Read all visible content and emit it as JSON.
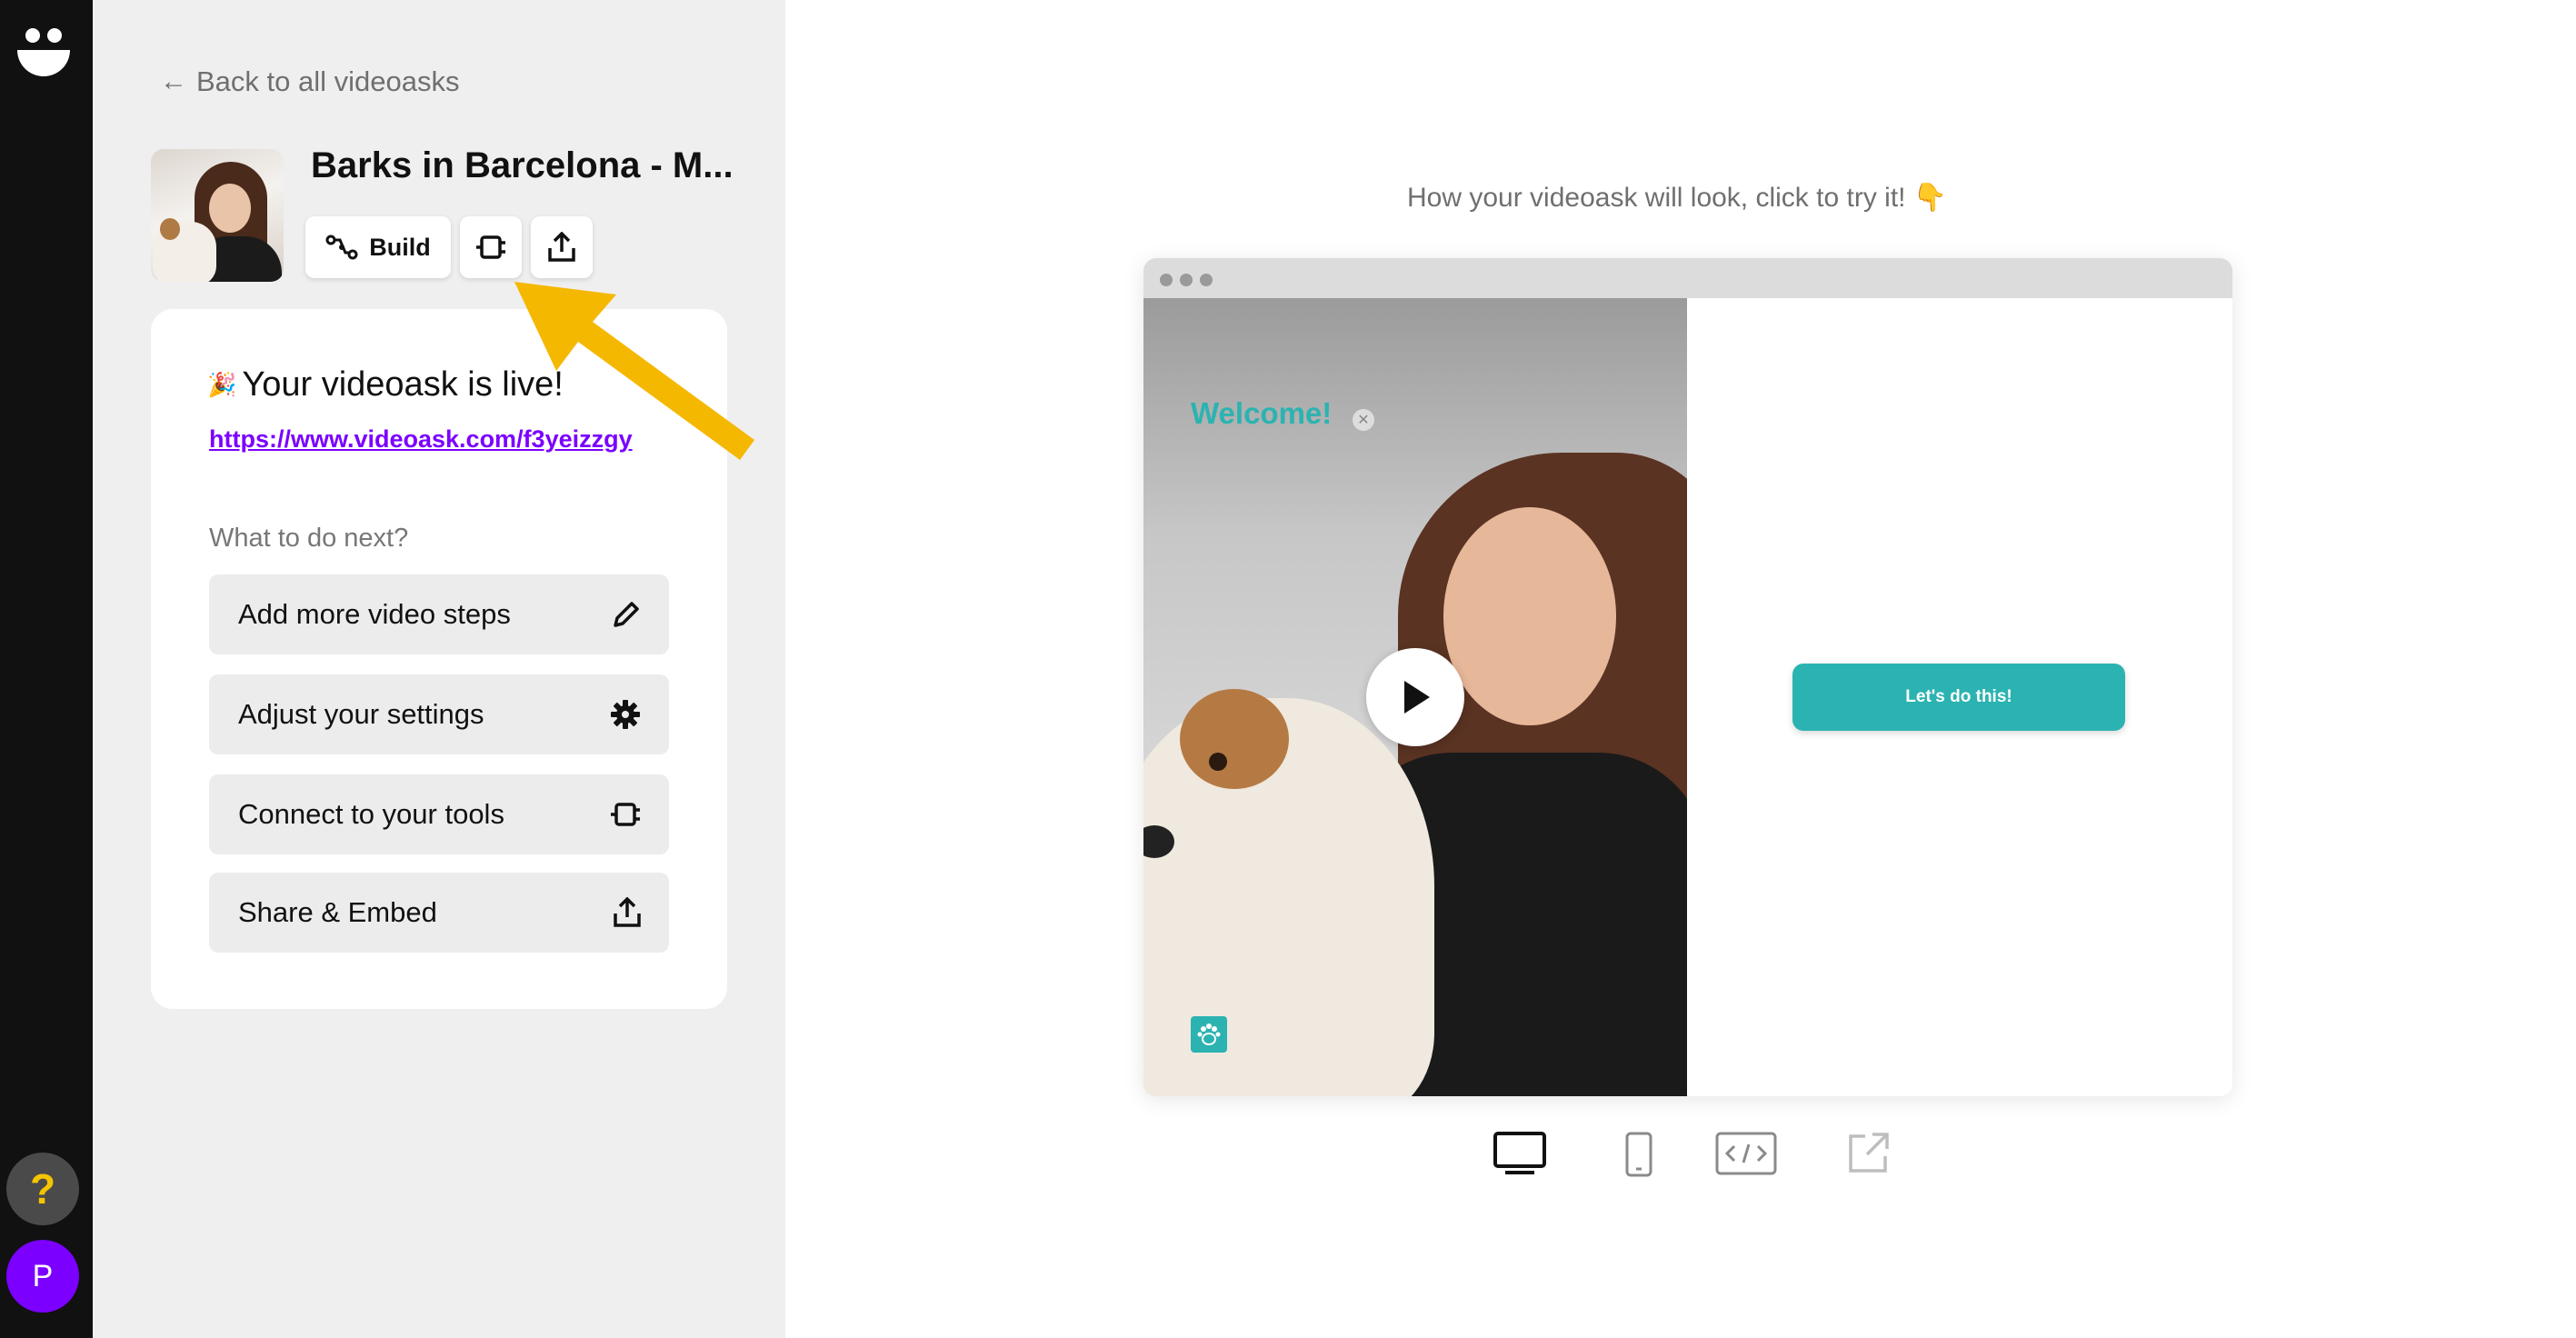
{
  "rail": {
    "help_label": "?",
    "avatar_initial": "P"
  },
  "sidebar": {
    "back_label": "Back to all videoasks",
    "videoask_title": "Barks in Barcelona - M...",
    "toolbar": {
      "build_label": "Build"
    },
    "card": {
      "live_emoji": "🎉",
      "live_title": "Your videoask is live!",
      "link": "https://www.videoask.com/f3yeizzgy",
      "next_heading": "What to do next?",
      "actions": [
        {
          "label": "Add more video steps",
          "icon": "pencil-icon"
        },
        {
          "label": "Adjust your settings",
          "icon": "gear-icon"
        },
        {
          "label": "Connect to your tools",
          "icon": "plug-icon"
        },
        {
          "label": "Share & Embed",
          "icon": "share-icon"
        }
      ]
    }
  },
  "preview": {
    "hint": "How your videoask will look, click to try it! 👇",
    "welcome": "Welcome!",
    "cta_label": "Let's do this!",
    "devices": [
      "desktop-icon",
      "mobile-icon",
      "embed-code-icon",
      "open-external-icon"
    ],
    "selected_device": "desktop-icon"
  },
  "colors": {
    "accent_purple": "#7b00ff",
    "teal": "#2bb3b1",
    "annotation_arrow": "#f5b800"
  }
}
